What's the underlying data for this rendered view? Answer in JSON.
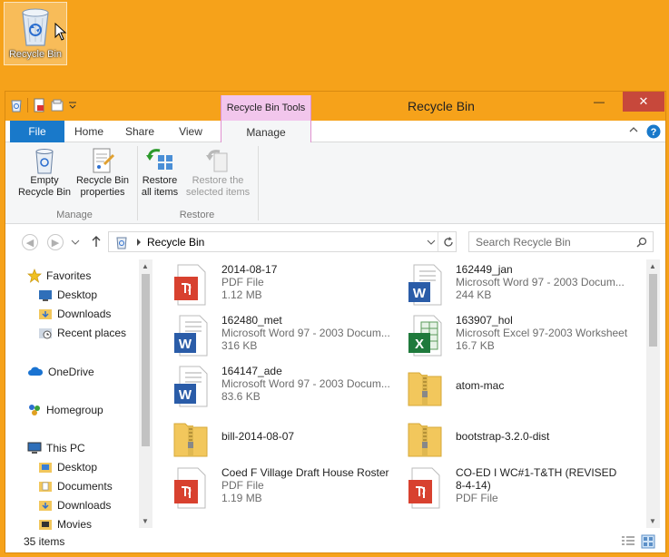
{
  "desktop": {
    "icon_label": "Recycle Bin"
  },
  "window": {
    "title": "Recycle Bin",
    "contextual_tab": "Recycle Bin Tools",
    "close_glyph": "✕",
    "minimize_glyph": "—",
    "maximize_glyph": "☐"
  },
  "tabs": {
    "file": "File",
    "home": "Home",
    "share": "Share",
    "view": "View",
    "manage": "Manage"
  },
  "ribbon": {
    "empty_line1": "Empty",
    "empty_line2": "Recycle Bin",
    "props_line1": "Recycle Bin",
    "props_line2": "properties",
    "restore_all_line1": "Restore",
    "restore_all_line2": "all items",
    "restore_sel_line1": "Restore the",
    "restore_sel_line2": "selected items",
    "group_manage": "Manage",
    "group_restore": "Restore"
  },
  "address": {
    "path": "Recycle Bin",
    "search_placeholder": "Search Recycle Bin"
  },
  "nav": {
    "favorites": "Favorites",
    "desktop": "Desktop",
    "downloads": "Downloads",
    "recent": "Recent places",
    "onedrive": "OneDrive",
    "homegroup": "Homegroup",
    "thispc": "This PC",
    "pc_desktop": "Desktop",
    "pc_documents": "Documents",
    "pc_downloads": "Downloads",
    "pc_movies": "Movies"
  },
  "files": [
    {
      "name": "2014-08-17",
      "type": "PDF File",
      "size": "1.12 MB",
      "icon": "pdf-icon"
    },
    {
      "name": "162449_jan",
      "type": "Microsoft Word 97 - 2003 Docum...",
      "size": "244 KB",
      "icon": "word-icon"
    },
    {
      "name": "162480_met",
      "type": "Microsoft Word 97 - 2003 Docum...",
      "size": "316 KB",
      "icon": "word-icon"
    },
    {
      "name": "163907_hol",
      "type": "Microsoft Excel 97-2003 Worksheet",
      "size": "16.7 KB",
      "icon": "excel-icon"
    },
    {
      "name": "164147_ade",
      "type": "Microsoft Word 97 - 2003 Docum...",
      "size": "83.6 KB",
      "icon": "word-icon"
    },
    {
      "name": "atom-mac",
      "type": "",
      "size": "",
      "icon": "zip-folder-icon"
    },
    {
      "name": "bill-2014-08-07",
      "type": "",
      "size": "",
      "icon": "zip-folder-icon"
    },
    {
      "name": "bootstrap-3.2.0-dist",
      "type": "",
      "size": "",
      "icon": "zip-folder-icon"
    },
    {
      "name": "Coed F Village Draft House Roster",
      "type": "PDF File",
      "size": "1.19 MB",
      "icon": "pdf-icon"
    },
    {
      "name": "CO-ED I WC#1-T&TH (REVISED",
      "name2": "8-4-14)",
      "type": "PDF File",
      "size": "",
      "icon": "pdf-icon"
    }
  ],
  "status": {
    "count": "35 items"
  }
}
